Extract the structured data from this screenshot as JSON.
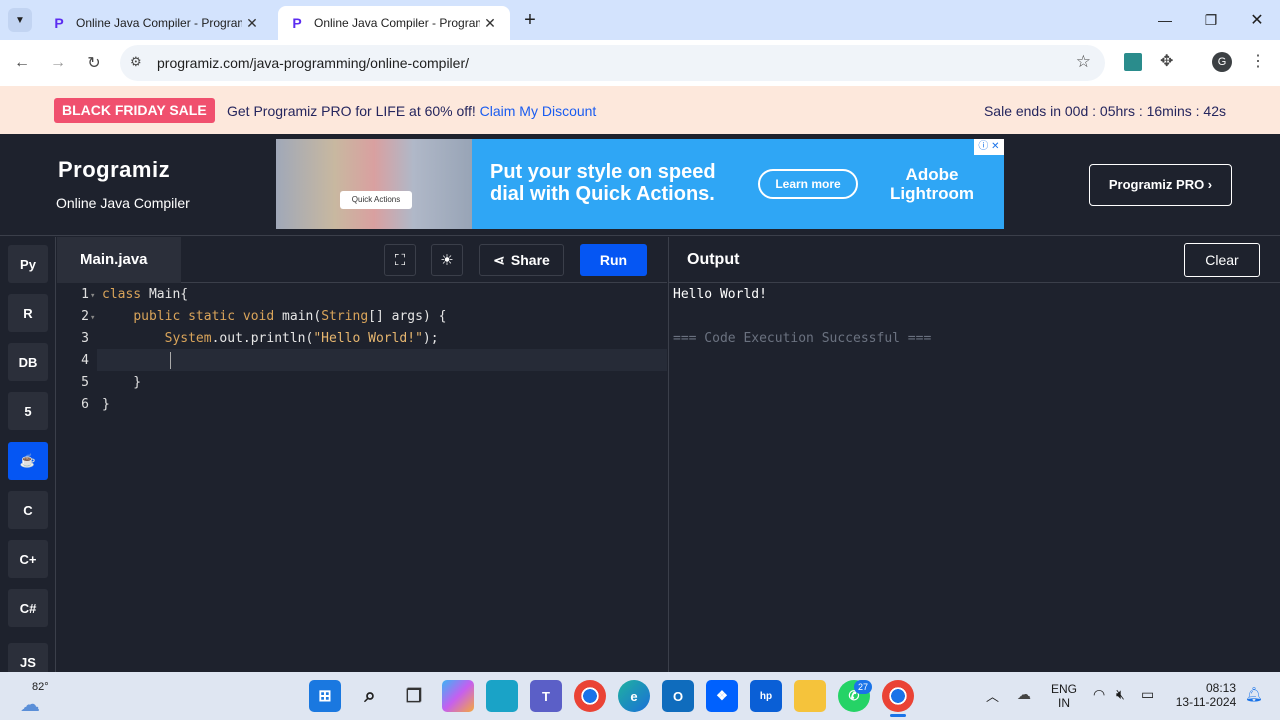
{
  "browser": {
    "tabs": [
      {
        "title": "Online Java Compiler - Program"
      },
      {
        "title": "Online Java Compiler - Program"
      }
    ],
    "url": "programiz.com/java-programming/online-compiler/",
    "profile_initial": "G"
  },
  "promo": {
    "badge": "BLACK FRIDAY SALE",
    "text": "Get Programiz PRO for LIFE at 60% off!",
    "link": "Claim My Discount",
    "timer": "Sale ends in 00d : 05hrs : 16mins : 42s"
  },
  "header": {
    "logo": "Programiz",
    "subtitle": "Online Java Compiler",
    "pro_button": "Programiz PRO ›"
  },
  "ad": {
    "headline": "Put your style on speed dial with Quick Actions.",
    "cta": "Learn more",
    "brand": "Adobe Lightroom",
    "chip": "Quick Actions"
  },
  "languages": [
    {
      "icon": "python-icon",
      "label": "Py"
    },
    {
      "icon": "r-icon",
      "label": "R"
    },
    {
      "icon": "sql-icon",
      "label": "DB"
    },
    {
      "icon": "html5-icon",
      "label": "5"
    },
    {
      "icon": "java-icon",
      "label": "☕"
    },
    {
      "icon": "c-icon",
      "label": "C"
    },
    {
      "icon": "cpp-icon",
      "label": "C+"
    },
    {
      "icon": "csharp-icon",
      "label": "C#"
    },
    {
      "icon": "js-icon",
      "label": "JS"
    }
  ],
  "editor": {
    "filename": "Main.java",
    "share_label": "Share",
    "run_label": "Run",
    "line_numbers": [
      "1",
      "2",
      "3",
      "4",
      "5",
      "6"
    ]
  },
  "output": {
    "title": "Output",
    "clear_label": "Clear",
    "line1": "Hello World!",
    "line2": "=== Code Execution Successful ==="
  },
  "taskbar": {
    "weather": "82°",
    "whatsapp_badge": "27",
    "lang_top": "ENG",
    "lang_bottom": "IN",
    "time": "08:13",
    "date": "13-11-2024"
  }
}
